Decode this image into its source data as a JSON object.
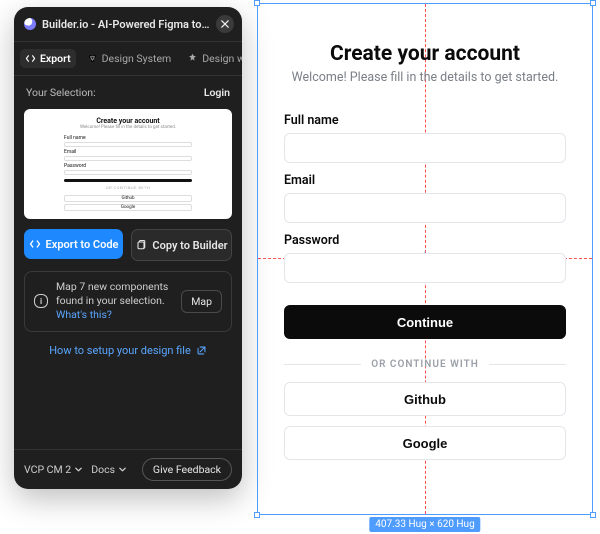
{
  "panel": {
    "title": "Builder.io - AI-Powered Figma to Code (React, V...",
    "tabs": {
      "export": "Export",
      "design_system": "Design System",
      "design_with_ai": "Design with AI"
    },
    "selection_label": "Your Selection:",
    "login": "Login",
    "export_btn": "Export to Code",
    "copy_btn": "Copy to Builder",
    "info_text": "Map 7 new components found in your selection. ",
    "info_link": "What's this?",
    "map_btn": "Map",
    "howto": "How to setup your design file",
    "footer_project": "VCP CM 2",
    "footer_docs": "Docs",
    "feedback": "Give Feedback"
  },
  "preview": {
    "title": "Create your account",
    "subtitle": "Welcome! Please fill in the details to get started.",
    "full_name": "Full name",
    "email": "Email",
    "password": "Password",
    "continue": "Continue",
    "divider": "OR CONTINUE WITH",
    "github": "Github",
    "google": "Google"
  },
  "form": {
    "title": "Create your account",
    "subtitle": "Welcome! Please fill in the details to get started.",
    "labels": {
      "full_name": "Full name",
      "email": "Email",
      "password": "Password"
    },
    "continue": "Continue",
    "divider": "OR CONTINUE WITH",
    "github": "Github",
    "google": "Google"
  },
  "selection_badge": "407.33 Hug × 620 Hug"
}
